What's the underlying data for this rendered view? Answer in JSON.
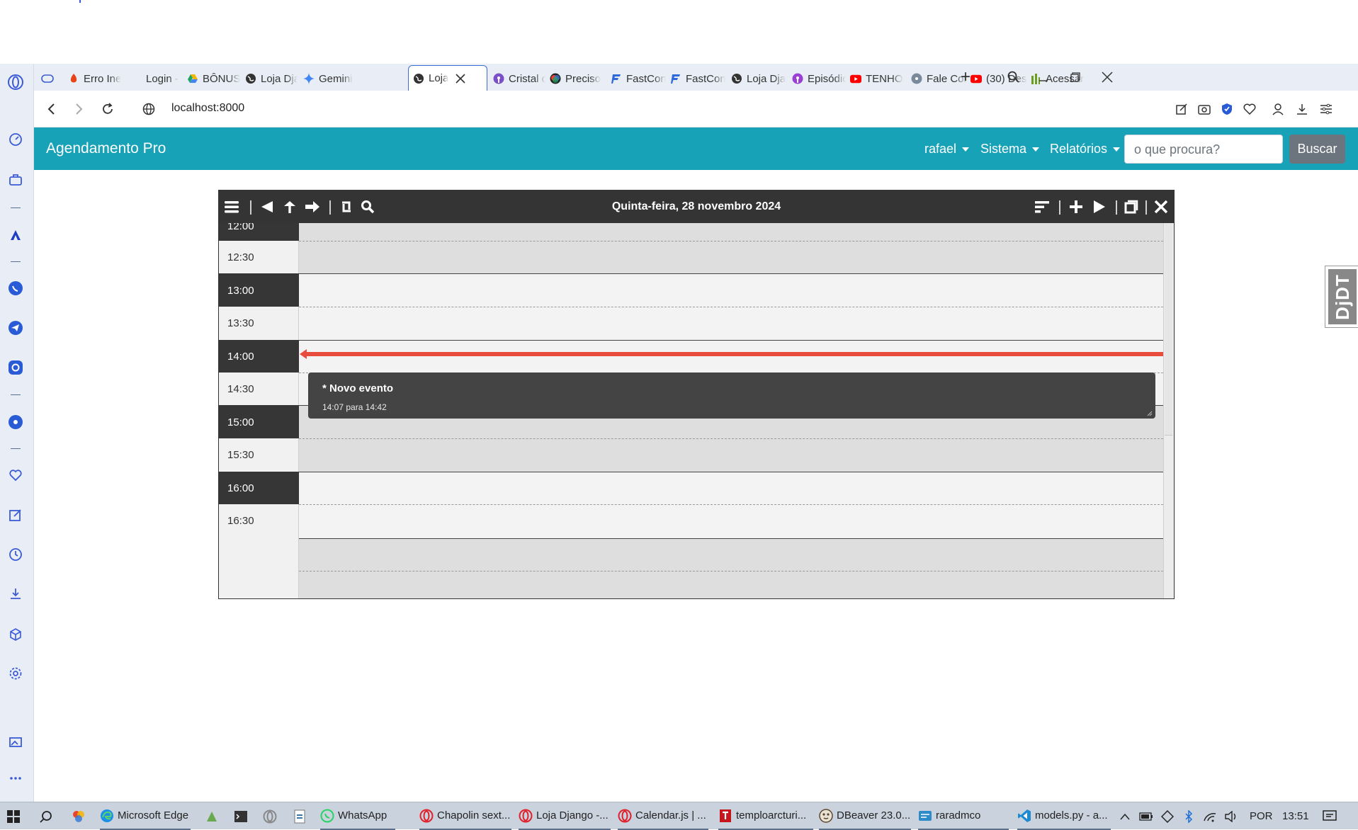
{
  "browser": {
    "tabs": [
      {
        "label": "Erro Ine",
        "icon": "flame-icon",
        "color": "#e8441c"
      },
      {
        "label": "Login -",
        "icon": "blank-page-icon",
        "color": "#888888"
      },
      {
        "label": "BÔNUS",
        "icon": "google-drive-icon",
        "color": "#1fa463"
      },
      {
        "label": "Loja Dja",
        "icon": "globe-icon",
        "color": "#333333"
      },
      {
        "label": "Gemini",
        "icon": "gemini-icon",
        "color": "#4285f4"
      },
      {
        "label": "Loja",
        "icon": "globe-icon",
        "color": "#333333",
        "active": true
      },
      {
        "label": "Cristal d",
        "icon": "podcast-icon",
        "color": "#7a4fc9"
      },
      {
        "label": "Preciso",
        "icon": "chatgpt-icon",
        "color": "#d03a3a"
      },
      {
        "label": "FastCon",
        "icon": "fastapi-icon",
        "color": "#2f6bd8"
      },
      {
        "label": "FastCon",
        "icon": "fastapi-icon",
        "color": "#2f6bd8"
      },
      {
        "label": "Loja Dja",
        "icon": "globe-icon",
        "color": "#333333"
      },
      {
        "label": "Episódic",
        "icon": "podcast-icon",
        "color": "#9b3fd6"
      },
      {
        "label": "TENHO",
        "icon": "youtube-icon",
        "color": "#ff0000"
      },
      {
        "label": "Fale Cor",
        "icon": "cd-icon",
        "color": "#7a8a9a"
      },
      {
        "label": "(30) Des",
        "icon": "youtube-icon",
        "color": "#ff0000"
      },
      {
        "label": "Acessar",
        "icon": "bars-icon",
        "color": "#6b9e1f"
      }
    ],
    "url": "localhost:8000"
  },
  "app": {
    "brand": "Agendamento Pro",
    "nav": {
      "user": "rafael",
      "sistema": "Sistema",
      "relatorios": "Relatórios"
    },
    "search": {
      "placeholder": "o que procura?",
      "button": "Buscar"
    }
  },
  "calendar": {
    "title": "Quinta-feira, 28 novembro 2024",
    "time_slots": [
      "12:00",
      "12:30",
      "13:00",
      "13:30",
      "14:00",
      "14:30",
      "15:00",
      "15:30",
      "16:00",
      "16:30"
    ],
    "event": {
      "title": "* Novo evento",
      "time": "14:07 para 14:42"
    }
  },
  "debug_toolbar": {
    "label": "DjDT"
  },
  "taskbar": {
    "items": [
      {
        "label": "Microsoft Edge",
        "icon": "edge-icon",
        "color": "#1b8ee8"
      },
      {
        "label": "WhatsApp",
        "icon": "whatsapp-icon",
        "color": "#25d366"
      },
      {
        "label": "Chapolin sext...",
        "icon": "opera-icon",
        "color": "#e0202c"
      },
      {
        "label": "Loja Django -...",
        "icon": "opera-icon",
        "color": "#e0202c"
      },
      {
        "label": "Calendar.js | ...",
        "icon": "opera-icon",
        "color": "#e0202c"
      },
      {
        "label": "temploarcturi...",
        "icon": "typora-icon",
        "color": "#c4161c"
      },
      {
        "label": "DBeaver 23.0....",
        "icon": "dbeaver-icon",
        "color": "#5a4632"
      },
      {
        "label": "raradmco",
        "icon": "db-icon",
        "color": "#2e8bc9"
      },
      {
        "label": "models.py - a...",
        "icon": "vscode-icon",
        "color": "#1f8ad2"
      }
    ],
    "language": "POR",
    "clock": "13:51"
  }
}
